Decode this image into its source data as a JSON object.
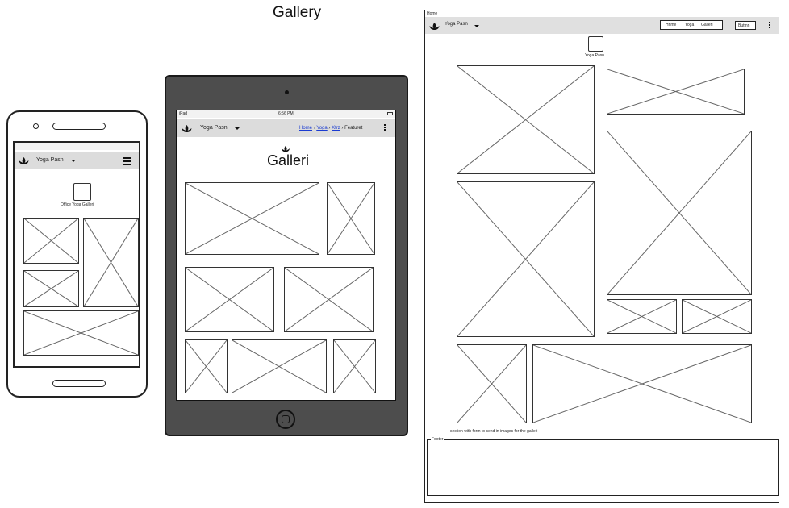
{
  "page": {
    "title": "Gallery"
  },
  "phone": {
    "brand": "Yoga Pasn",
    "page_heading": "Office Yoga Galleri"
  },
  "tablet": {
    "status_carrier": "iPad",
    "status_time": "6:56 PM",
    "brand": "Yoga Pasn",
    "breadcrumb": [
      "Home",
      "Yoga",
      "Xtrz",
      "Featuret"
    ],
    "heading": "Galleri"
  },
  "desktop": {
    "window_title": "Home",
    "brand": "Yoga Pasn",
    "nav_links": [
      "Hnme",
      "Yoga",
      "Galleri"
    ],
    "button_label": "Buttnn",
    "logo_caption": "Yoga Pasn",
    "section_note": "section with form to send in images for the galleri",
    "footer_label": "Footer"
  },
  "icons": {
    "brand": "lotus-icon",
    "dropdown": "chevron-down-icon",
    "menu": "hamburger-icon",
    "more": "kebab-menu-icon",
    "home_button": "home-button-icon"
  }
}
